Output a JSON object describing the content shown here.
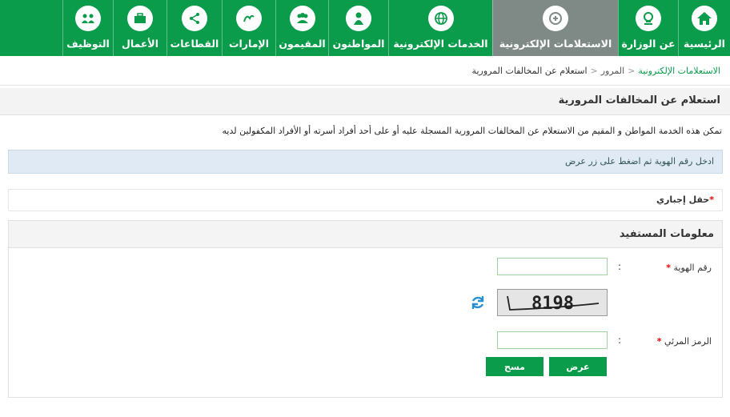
{
  "nav": {
    "items": [
      {
        "label": "الرئيسية",
        "icon": "home-icon"
      },
      {
        "label": "عن الوزارة",
        "icon": "emblem-icon"
      },
      {
        "label": "الاستعلامات الإلكترونية",
        "icon": "inquiry-icon",
        "active": true
      },
      {
        "label": "الخدمات الإلكترونية",
        "icon": "globe-icon"
      },
      {
        "label": "المواطنون",
        "icon": "citizen-icon"
      },
      {
        "label": "المقيمون",
        "icon": "residents-icon"
      },
      {
        "label": "الإمارات",
        "icon": "emirates-icon"
      },
      {
        "label": "القطاعات",
        "icon": "sectors-icon"
      },
      {
        "label": "الأعمال",
        "icon": "briefcase-icon"
      },
      {
        "label": "التوظيف",
        "icon": "employment-icon"
      }
    ]
  },
  "breadcrumb": {
    "level1": "الاستعلامات الإلكترونية",
    "level2": "المرور",
    "current": "استعلام عن المخالفات المرورية"
  },
  "page": {
    "title": "استعلام عن المخالفات المرورية",
    "description": "تمكن هذه الخدمة المواطن و المقيم من الاستعلام عن المخالفات المرورية المسجلة عليه أو على أحد أفراد أسرته أو الأفراد المكفولين لديه",
    "info": "ادخل رقم الهوية ثم اضغط على زر عرض",
    "required_note": "حقل إجباري",
    "required_mark": "*"
  },
  "form": {
    "section_title": "معلومات المستفيد",
    "id_label": "رقم الهوية",
    "id_value": "",
    "captcha_text": "8198",
    "code_label": "الرمز المرئي",
    "code_value": "",
    "colon": ":",
    "submit_label": "عرض",
    "clear_label": "مسح"
  },
  "colors": {
    "brand": "#0a9b4b",
    "active_tab": "#7f8a87",
    "info_bg": "#dfeaf4"
  }
}
